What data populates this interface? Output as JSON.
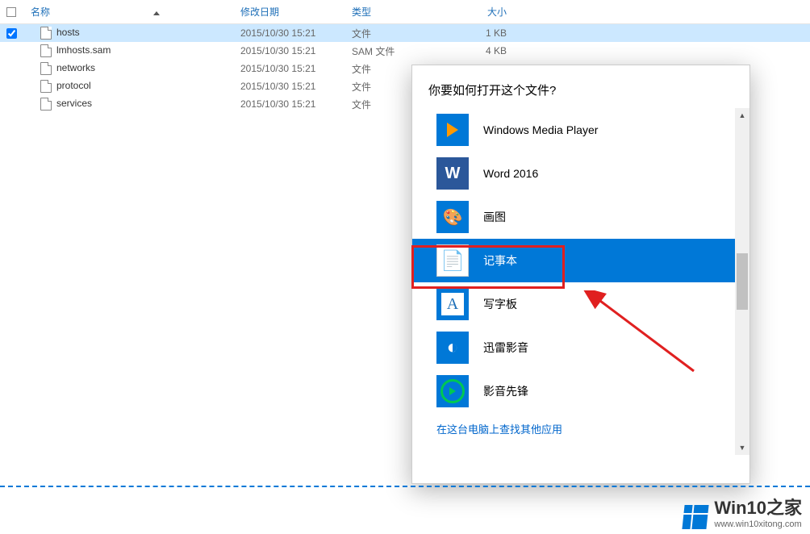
{
  "columns": {
    "name": "名称",
    "date": "修改日期",
    "type": "类型",
    "size": "大小"
  },
  "files": [
    {
      "name": "hosts",
      "date": "2015/10/30 15:21",
      "type": "文件",
      "size": "1 KB",
      "selected": true,
      "checked": true
    },
    {
      "name": "lmhosts.sam",
      "date": "2015/10/30 15:21",
      "type": "SAM 文件",
      "size": "4 KB",
      "selected": false,
      "checked": false
    },
    {
      "name": "networks",
      "date": "2015/10/30 15:21",
      "type": "文件",
      "size": "",
      "selected": false,
      "checked": false
    },
    {
      "name": "protocol",
      "date": "2015/10/30 15:21",
      "type": "文件",
      "size": "",
      "selected": false,
      "checked": false
    },
    {
      "name": "services",
      "date": "2015/10/30 15:21",
      "type": "文件",
      "size": "",
      "selected": false,
      "checked": false
    }
  ],
  "dialog": {
    "title": "你要如何打开这个文件?",
    "apps": [
      {
        "label": "Windows Media Player",
        "icon": "wmp",
        "selected": false
      },
      {
        "label": "Word 2016",
        "icon": "word",
        "icon_text": "W",
        "selected": false
      },
      {
        "label": "画图",
        "icon": "paint",
        "selected": false
      },
      {
        "label": "记事本",
        "icon": "notepad",
        "selected": true
      },
      {
        "label": "写字板",
        "icon": "wordpad",
        "selected": false
      },
      {
        "label": "迅雷影音",
        "icon": "thunder",
        "selected": false
      },
      {
        "label": "影音先锋",
        "icon": "player",
        "selected": false
      }
    ],
    "more_link": "在这台电脑上查找其他应用"
  },
  "watermark": {
    "title": "Win10之家",
    "url": "www.win10xitong.com"
  }
}
